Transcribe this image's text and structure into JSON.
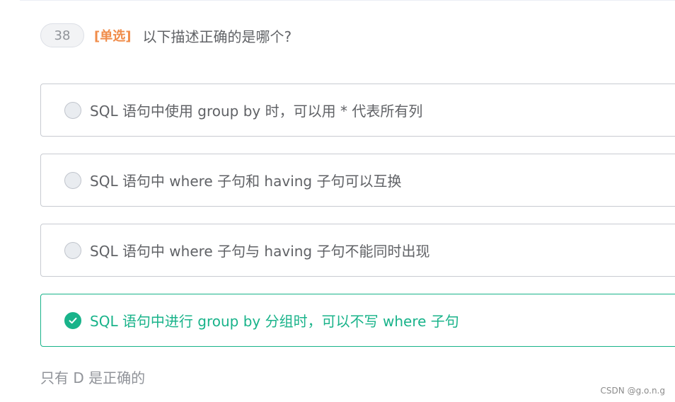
{
  "question": {
    "number": "38",
    "type_label": "[单选]",
    "text": "以下描述正确的是哪个?"
  },
  "options": [
    {
      "text": "SQL 语句中使用 group by 时，可以用 * 代表所有列",
      "selected": false
    },
    {
      "text": "SQL 语句中 where 子句和 having 子句可以互换",
      "selected": false
    },
    {
      "text": "SQL 语句中 where 子句与 having 子句不能同时出现",
      "selected": false
    },
    {
      "text": "SQL 语句中进行 group by 分组时，可以不写 where 子句",
      "selected": true
    }
  ],
  "answer_note": "只有 D 是正确的",
  "watermark": "CSDN @g.o.n.g",
  "colors": {
    "accent_green": "#19b38a",
    "type_orange": "#f08c4a",
    "text_gray": "#606266"
  },
  "icons": {
    "selected": "check-circle-icon",
    "unselected": "radio-empty-icon"
  }
}
